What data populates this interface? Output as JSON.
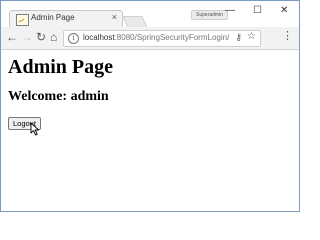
{
  "tab": {
    "title": "Admin Page",
    "close": "×"
  },
  "profile": {
    "name": "Superadmin"
  },
  "window_controls": {
    "minimize": "—",
    "maximize": "☐",
    "close": "✕"
  },
  "toolbar": {
    "back": "←",
    "forward": "→",
    "reload": "↻",
    "home": "⌂",
    "info": "i",
    "url_host": "localhost",
    "url_rest": ":8080/SpringSecurityFormLogin/a...",
    "key": "⚷",
    "star": "☆",
    "menu": "⋮"
  },
  "page": {
    "heading": "Admin Page",
    "welcome": "Welcome: admin",
    "logout_label": "Logout"
  }
}
